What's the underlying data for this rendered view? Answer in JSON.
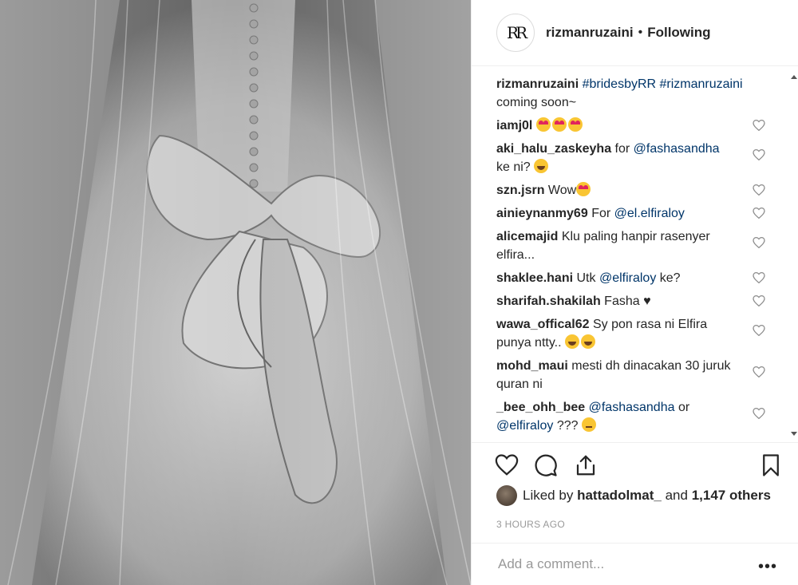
{
  "header": {
    "username": "rizmanruzaini",
    "separator": "•",
    "follow_label": "Following",
    "logo_text": "RR"
  },
  "caption": {
    "username": "rizmanruzaini",
    "tags": "#bridesbyRR #rizmanruzaini",
    "text": "coming soon~"
  },
  "comments": [
    {
      "user": "iamj0l",
      "text": "",
      "emoji": [
        "heart-eyes",
        "heart-eyes",
        "heart-eyes"
      ]
    },
    {
      "user": "aki_halu_zaskeyha",
      "text": "for",
      "mention": "@fashasandha",
      "text2": "ke ni?",
      "emoji": [
        "rofl"
      ]
    },
    {
      "user": "szn.jsrn",
      "text": "Wow",
      "emoji": [
        "heart-eyes"
      ]
    },
    {
      "user": "ainieynanmy69",
      "text": "For",
      "mention": "@el.elfiraloy"
    },
    {
      "user": "alicemajid",
      "text": "Klu paling hanpir rasenyer elfira..."
    },
    {
      "user": "shaklee.hani",
      "text": "Utk",
      "mention": "@elfiraloy",
      "text2": "ke?"
    },
    {
      "user": "sharifah.shakilah",
      "text": "Fasha",
      "symbol": "♥"
    },
    {
      "user": "wawa_offical62",
      "text": "Sy pon rasa ni Elfira punya ntty..",
      "emoji": [
        "grin",
        "grin"
      ]
    },
    {
      "user": "mohd_maui",
      "text": "mesti dh dinacakan 30 juruk quran ni"
    },
    {
      "user": "_bee_ohh_bee",
      "mention": "@fashasandha",
      "text": "or",
      "mention2": "@elfiraloy",
      "text2": "???",
      "emoji": [
        "thinking"
      ]
    }
  ],
  "likes": {
    "prefix": "Liked by",
    "user": "hattadolmat_",
    "and": "and",
    "count": "1,147 others"
  },
  "timestamp": "3 HOURS AGO",
  "add_comment": {
    "placeholder": "Add a comment..."
  },
  "more_label": "•••"
}
